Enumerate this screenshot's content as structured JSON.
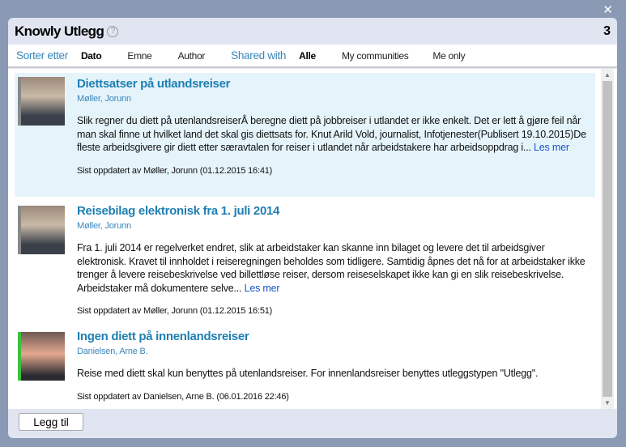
{
  "window": {
    "close_icon": "close-icon"
  },
  "header": {
    "title": "Knowly Utlegg",
    "help_icon": "?",
    "count": "3"
  },
  "toolbar": {
    "sort_label": "Sorter etter",
    "sort_options": [
      "Dato",
      "Emne",
      "Author"
    ],
    "sort_selected": "Dato",
    "shared_label": "Shared with",
    "shared_options": [
      "Alle",
      "My communities",
      "Me only"
    ],
    "shared_selected": "Alle"
  },
  "items": [
    {
      "title": "Diettsatser på utlandsreiser",
      "author": "Møller, Jorunn",
      "text": "Slik regner du diett på utenlandsreiserÅ beregne diett på jobbreiser i utlandet er ikke enkelt. Det er lett å gjøre feil når man skal finne ut hvilket land det skal gis diettsats for. Knut Arild Vold, journalist, Infotjenester(Publisert 19.10.2015)De fleste arbeidsgivere gir diett etter særavtalen for reiser i utlandet når arbeidstakere har arbeidsoppdrag i...",
      "more": "Les mer",
      "updated": "Sist oppdatert av Møller, Jorunn (01.12.2015 16:41)"
    },
    {
      "title": "Reisebilag elektronisk fra 1. juli 2014",
      "author": "Møller, Jorunn",
      "text": "Fra 1. juli 2014 er regelverket endret, slik at arbeidstaker kan skanne inn bilaget og levere det til arbeidsgiver elektronisk. Kravet til innholdet i reiseregningen beholdes som tidligere. Samtidig åpnes det nå for at arbeidstaker ikke trenger å levere reisebeskrivelse ved billettløse reiser, dersom reiseselskapet ikke kan gi en slik reisebeskrivelse. Arbeidstaker må dokumentere selve...",
      "more": "Les mer",
      "updated": "Sist oppdatert av Møller, Jorunn (01.12.2015 16:51)"
    },
    {
      "title": "Ingen diett på innenlandsreiser",
      "author": "Danielsen, Arne B.",
      "text": "Reise med diett skal kun benyttes på utenlandsreiser. For innenlandsreiser benyttes utleggstypen \"Utlegg\".",
      "updated": "Sist oppdatert av Danielsen, Arne B. (06.01.2016 22:46)"
    }
  ],
  "footer": {
    "add_label": "Legg til"
  }
}
